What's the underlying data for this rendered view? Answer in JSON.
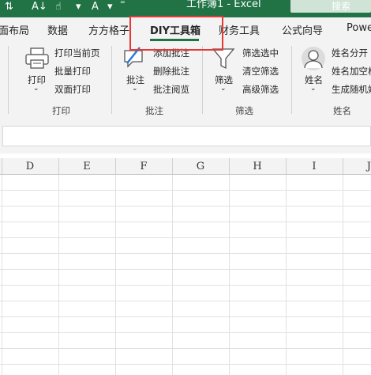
{
  "titlebar": {
    "doc_title": "工作簿1 - Excel",
    "search_label": "搜索",
    "qa_icons": [
      "sort-icon",
      "sort-az-icon",
      "touch-mode-icon",
      "font-color-icon",
      "customize-toolbar-icon"
    ]
  },
  "tabs": [
    {
      "label": "页面布局",
      "visible_text": "面布局"
    },
    {
      "label": "数据"
    },
    {
      "label": "方方格子"
    },
    {
      "label": "DIY工具箱",
      "active": true
    },
    {
      "label": "财务工具"
    },
    {
      "label": "公式向导"
    },
    {
      "label": "Power"
    }
  ],
  "ribbon": {
    "print_group": {
      "label": "打印",
      "big_button": "打印",
      "items": [
        "打印当前页",
        "批量打印",
        "双面打印"
      ]
    },
    "comment_group": {
      "label": "批注",
      "big_button": "批注",
      "items": [
        "添加批注",
        "删除批注",
        "批注阅览"
      ]
    },
    "filter_group": {
      "label": "筛选",
      "big_button": "筛选",
      "items": [
        "筛选选中",
        "清空筛选",
        "高级筛选"
      ]
    },
    "name_group": {
      "label": "姓名",
      "big_button": "姓名",
      "items": [
        "姓名分开",
        "姓名加空格",
        "生成随机姓"
      ]
    }
  },
  "columns": [
    "D",
    "E",
    "F",
    "G",
    "H",
    "I",
    "J"
  ],
  "colors": {
    "excel_green": "#217346",
    "highlight": "#e53935"
  }
}
